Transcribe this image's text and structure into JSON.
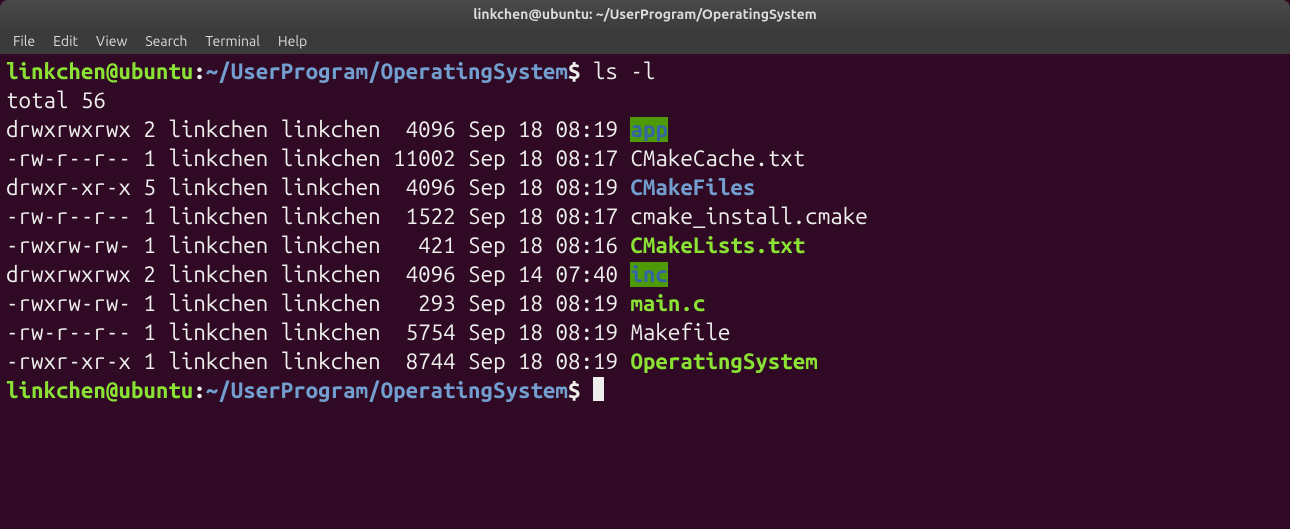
{
  "window": {
    "title": "linkchen@ubuntu: ~/UserProgram/OperatingSystem"
  },
  "menu": {
    "items": [
      "File",
      "Edit",
      "View",
      "Search",
      "Terminal",
      "Help"
    ]
  },
  "prompt": {
    "user": "linkchen@ubuntu",
    "sep": ":",
    "path": "~/UserProgram/OperatingSystem",
    "sign": "$"
  },
  "command": "ls -l",
  "total_line": "total 56",
  "listing": [
    {
      "perms": "drwxrwxrwx",
      "links": "2",
      "owner": "linkchen",
      "group": "linkchen",
      "size": " 4096",
      "date": "Sep 18 08:19",
      "name": "app",
      "class": "file-sticky"
    },
    {
      "perms": "-rw-r--r--",
      "links": "1",
      "owner": "linkchen",
      "group": "linkchen",
      "size": "11002",
      "date": "Sep 18 08:17",
      "name": "CMakeCache.txt",
      "class": "file-normal"
    },
    {
      "perms": "drwxr-xr-x",
      "links": "5",
      "owner": "linkchen",
      "group": "linkchen",
      "size": " 4096",
      "date": "Sep 18 08:19",
      "name": "CMakeFiles",
      "class": "file-dir-link"
    },
    {
      "perms": "-rw-r--r--",
      "links": "1",
      "owner": "linkchen",
      "group": "linkchen",
      "size": " 1522",
      "date": "Sep 18 08:17",
      "name": "cmake_install.cmake",
      "class": "file-normal"
    },
    {
      "perms": "-rwxrw-rw-",
      "links": "1",
      "owner": "linkchen",
      "group": "linkchen",
      "size": "  421",
      "date": "Sep 18 08:16",
      "name": "CMakeLists.txt",
      "class": "file-exec"
    },
    {
      "perms": "drwxrwxrwx",
      "links": "2",
      "owner": "linkchen",
      "group": "linkchen",
      "size": " 4096",
      "date": "Sep 14 07:40",
      "name": "inc",
      "class": "file-sticky"
    },
    {
      "perms": "-rwxrw-rw-",
      "links": "1",
      "owner": "linkchen",
      "group": "linkchen",
      "size": "  293",
      "date": "Sep 18 08:19",
      "name": "main.c",
      "class": "file-exec"
    },
    {
      "perms": "-rw-r--r--",
      "links": "1",
      "owner": "linkchen",
      "group": "linkchen",
      "size": " 5754",
      "date": "Sep 18 08:19",
      "name": "Makefile",
      "class": "file-normal"
    },
    {
      "perms": "-rwxr-xr-x",
      "links": "1",
      "owner": "linkchen",
      "group": "linkchen",
      "size": " 8744",
      "date": "Sep 18 08:19",
      "name": "OperatingSystem",
      "class": "file-exec"
    }
  ]
}
